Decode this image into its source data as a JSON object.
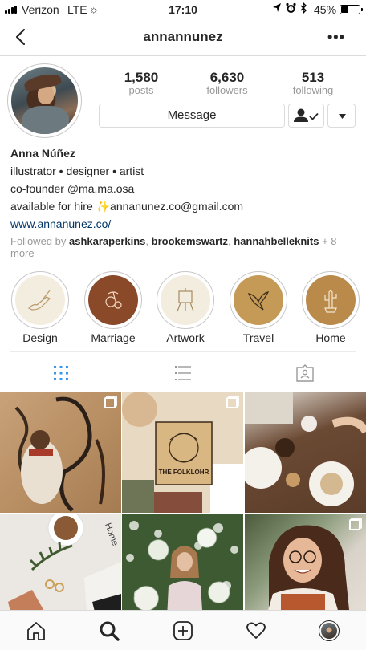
{
  "status_bar": {
    "carrier": "Verizon",
    "network": "LTE",
    "activity": "☼",
    "time": "17:10",
    "battery": "45%",
    "battery_level": 0.45
  },
  "nav": {
    "username": "annannunez",
    "more": "•••"
  },
  "profile": {
    "stats": [
      {
        "value": "1,580",
        "label": "posts"
      },
      {
        "value": "6,630",
        "label": "followers"
      },
      {
        "value": "513",
        "label": "following"
      }
    ],
    "message_button": "Message",
    "name": "Anna Núñez",
    "bio_lines": [
      "illustrator • designer • artist",
      "co-founder @ma.ma.osa",
      "available for hire ✨annanunez.co@gmail.com"
    ],
    "website": "www.annanunez.co/",
    "followed_by": {
      "prefix": "Followed by",
      "users": [
        "ashkaraperkins",
        "brookemswartz",
        "hannahbelleknits"
      ],
      "suffix": "+ 8 more"
    }
  },
  "highlights": [
    {
      "label": "Design",
      "bg": "#f3ede0",
      "icon": "hand-drawing-icon"
    },
    {
      "label": "Marriage",
      "bg": "#8a4a2a",
      "icon": "orange-branch-icon"
    },
    {
      "label": "Artwork",
      "bg": "#f3ede0",
      "icon": "easel-icon"
    },
    {
      "label": "Travel",
      "bg": "#c49a56",
      "icon": "bird-icon"
    },
    {
      "label": "Home",
      "bg": "#b98a4a",
      "icon": "cactus-icon"
    }
  ],
  "grid_posts": [
    {
      "name": "post-paper-snakes",
      "multi": true
    },
    {
      "name": "post-the-folklohr",
      "caption": "THE FOLKLOHR",
      "multi": true
    },
    {
      "name": "post-brunch-table",
      "multi": false
    },
    {
      "name": "post-coffee-desk",
      "caption": "Home",
      "multi": false
    },
    {
      "name": "post-flower-wall",
      "multi": false
    },
    {
      "name": "post-smiling-girl",
      "multi": true
    }
  ],
  "colors": {
    "link": "#003569",
    "secondary_text": "#999999",
    "border": "#dbdbdb",
    "active_tab": "#3897f0"
  }
}
